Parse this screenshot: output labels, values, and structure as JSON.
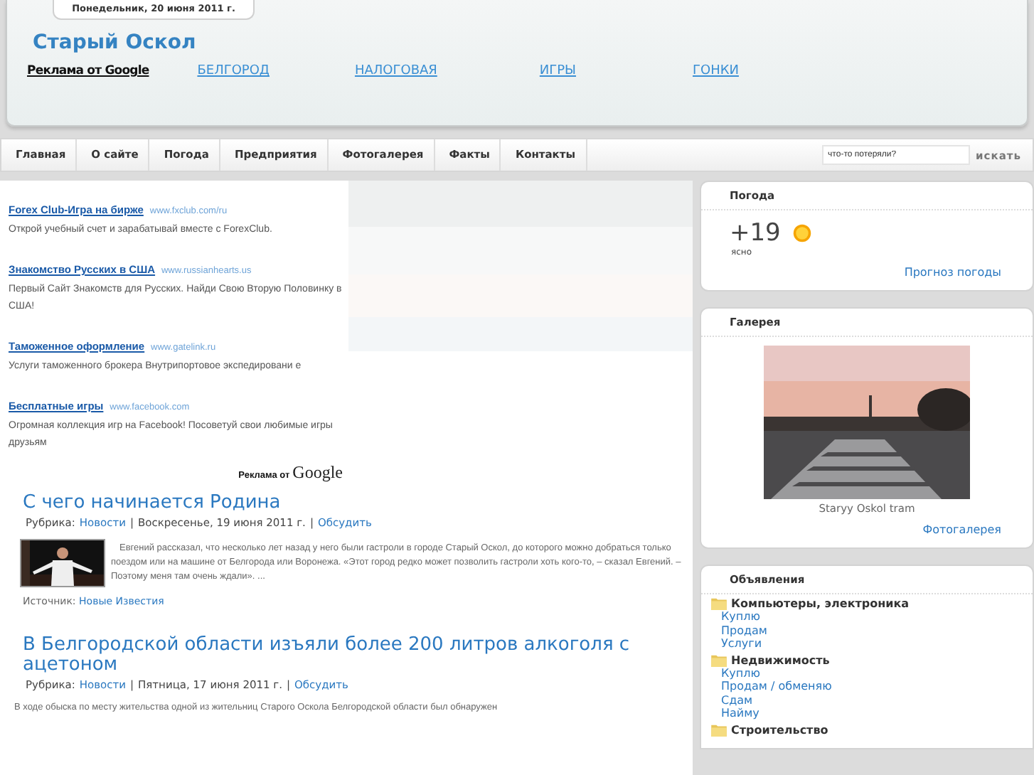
{
  "header": {
    "date": "Понедельник, 20 июня 2011 г.",
    "site_title": "Старый Оскол",
    "links": [
      {
        "text": "Реклама от Google",
        "kind": "google"
      },
      {
        "text": "БЕЛГОРОД",
        "kind": "link"
      },
      {
        "text": "НАЛОГОВАЯ",
        "kind": "link"
      },
      {
        "text": "ИГРЫ",
        "kind": "link"
      },
      {
        "text": "ГОНКИ",
        "kind": "link"
      }
    ]
  },
  "nav": {
    "items": [
      "Главная",
      "О сайте",
      "Погода",
      "Предприятия",
      "Фотогалерея",
      "Факты",
      "Контакты"
    ],
    "search": {
      "placeholder": "что-то потеряли?"
    },
    "search_button": "искать"
  },
  "ads": {
    "items": [
      {
        "title": "Forex Club-Игра на бирже",
        "url": "www.fxclub.com/ru",
        "text": "Открой учебный счет и зарабатывай вместе с ForexClub."
      },
      {
        "title": "Знакомство Русских в США",
        "url": "www.russianhearts.us",
        "text": "Первый Сайт Знакомств для Русских. Найди Свою Вторую Половинку в США!"
      },
      {
        "title": "Таможенное оформление",
        "url": "www.gatelink.ru",
        "text": "Услуги таможенного брокера Внутрипортовое экспедировани е"
      },
      {
        "title": "Бесплатные игры",
        "url": "www.facebook.com",
        "text": "Огромная коллекция игр на Facebook! Посоветуй свои любимые игры друзьям"
      }
    ],
    "footer_prefix": "Реклама от",
    "footer_brand": "Google"
  },
  "articles": [
    {
      "title": "С чего начинается Родина",
      "meta": [
        {
          "kind": "label",
          "text": "Рубрика:"
        },
        {
          "kind": "link",
          "text": "Новости"
        },
        {
          "kind": "sep",
          "text": "|"
        },
        {
          "kind": "text",
          "text": "Воскресенье, 19 июня 2011 г."
        },
        {
          "kind": "sep",
          "text": "|"
        },
        {
          "kind": "link",
          "text": "Обсудить"
        }
      ],
      "picture": {
        "kind": "picture"
      },
      "body": "Евгений рассказал, что несколько лет назад у него были гастроли в городе Старый Оскол, до которого можно добраться только поездом или на машине от Белгорода или Воронежа.  «Этот город редко может позволить гастроли хоть кого-то, – сказал Евгений. – Поэтому меня там очень ждали». ...",
      "source_label": "Источник:",
      "source": "Новые Известия"
    },
    {
      "title": "В Белгородской области изъяли более 200 литров алкоголя с ацетоном",
      "meta": [
        {
          "kind": "label",
          "text": "Рубрика:"
        },
        {
          "kind": "link",
          "text": "Новости"
        },
        {
          "kind": "sep",
          "text": "|"
        },
        {
          "kind": "text",
          "text": "Пятница, 17 июня 2011 г."
        },
        {
          "kind": "sep",
          "text": "|"
        },
        {
          "kind": "link",
          "text": "Обсудить"
        }
      ],
      "body": "В ходе обыска по месту жительства одной из жительниц Старого Оскола Белгородской области был обнаружен"
    }
  ],
  "weather": {
    "title": "Погода",
    "temp": "+19",
    "condition": "ясно",
    "link": "Прогноз погоды"
  },
  "gallery": {
    "title": "Галерея",
    "picture": {
      "kind": "picture"
    },
    "caption": "Staryy Oskol tram",
    "link": "Фотогалерея"
  },
  "classifieds": {
    "title": "Объявления",
    "groups": [
      {
        "name": "Компьютеры, электроника",
        "items": [
          "Куплю",
          "Продам",
          "Услуги"
        ]
      },
      {
        "name": "Недвижимость",
        "items": [
          "Куплю",
          "Продам / обменяю",
          "Сдам",
          "Найму"
        ]
      },
      {
        "name": "Строительство"
      }
    ]
  }
}
